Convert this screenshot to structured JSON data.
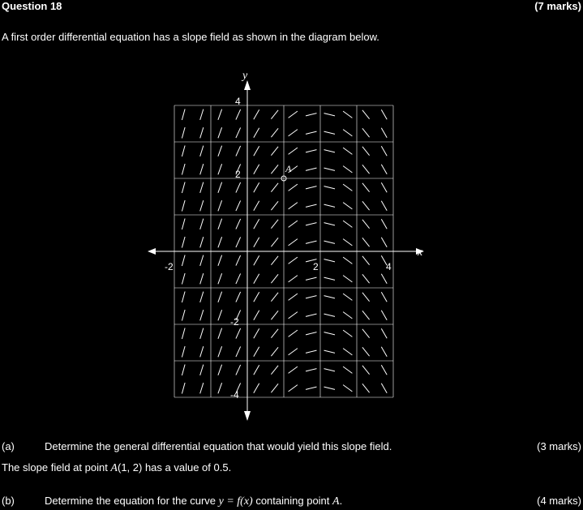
{
  "header": {
    "question_title": "Question 18",
    "marks": "(7 marks)"
  },
  "intro": "A first order differential equation has a slope field as shown in the diagram below.",
  "diagram": {
    "x_axis_label": "x",
    "y_axis_label": "y",
    "x_ticks": [
      "-2",
      "2",
      "4"
    ],
    "y_ticks": [
      "4",
      "2",
      "-2",
      "-4"
    ],
    "point_label": "A",
    "slope_rule": "dy/dx = 2 - x (slope independent of y)",
    "x_range": [
      -2,
      4
    ],
    "y_range": [
      -4,
      4
    ],
    "grid_step": 1,
    "line_color": "#ffffff"
  },
  "part_a": {
    "label": "(a)",
    "text": "Determine the general differential equation that would yield this slope field.",
    "marks": "(3 marks)"
  },
  "condition": {
    "prefix": "The slope field at point ",
    "point": "A",
    "coords": "(1, 2)",
    "suffix": " has a value of 0.5."
  },
  "part_b": {
    "label": "(b)",
    "prefix": "Determine the equation for the curve ",
    "curve": "y = f(x)",
    "middle": " containing point ",
    "point": "A",
    "suffix": ".",
    "marks": "(4 marks)"
  }
}
